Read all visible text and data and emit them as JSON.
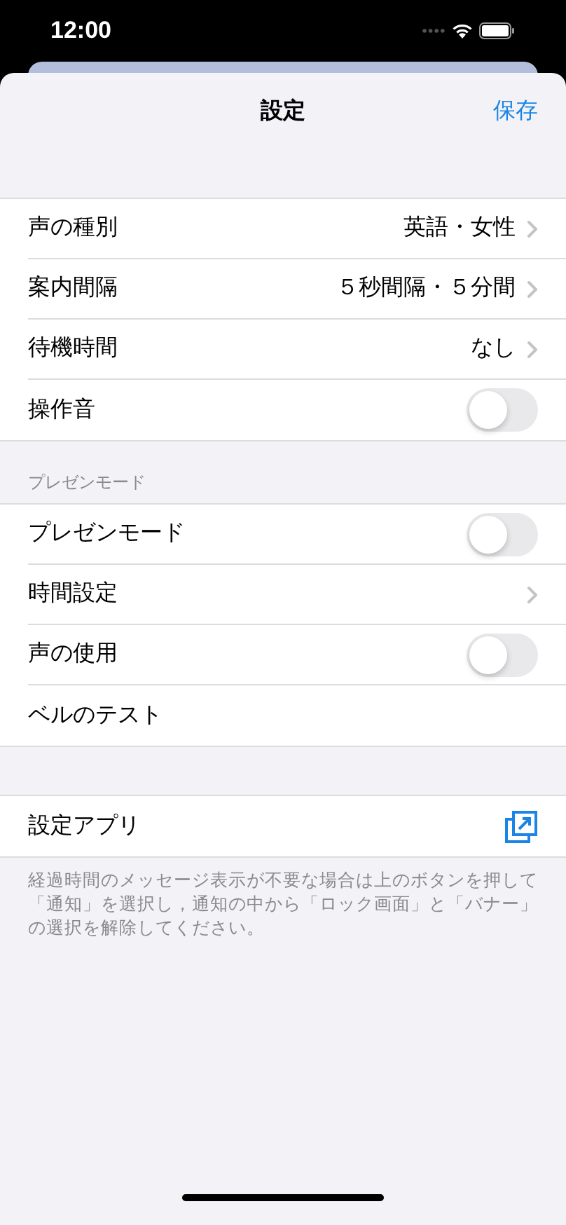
{
  "status_bar": {
    "time": "12:00"
  },
  "nav": {
    "title": "設定",
    "action": "保存"
  },
  "groups": [
    {
      "rows": [
        {
          "kind": "value",
          "label": "声の種別",
          "value": "英語・女性"
        },
        {
          "kind": "value",
          "label": "案内間隔",
          "value": "５秒間隔・５分間"
        },
        {
          "kind": "value",
          "label": "待機時間",
          "value": "なし"
        },
        {
          "kind": "toggle",
          "label": "操作音",
          "on": false
        }
      ]
    },
    {
      "header": "プレゼンモード",
      "rows": [
        {
          "kind": "toggle",
          "label": "プレゼンモード",
          "on": false
        },
        {
          "kind": "link",
          "label": "時間設定"
        },
        {
          "kind": "toggle",
          "label": "声の使用",
          "on": false
        },
        {
          "kind": "plain",
          "label": "ベルのテスト"
        }
      ]
    },
    {
      "rows": [
        {
          "kind": "external",
          "label": "設定アプリ"
        }
      ],
      "footer": "経過時間のメッセージ表示が不要な場合は上のボタンを押して「通知」を選択し，通知の中から「ロック画面」と「バナー」の選択を解除してください。"
    }
  ]
}
